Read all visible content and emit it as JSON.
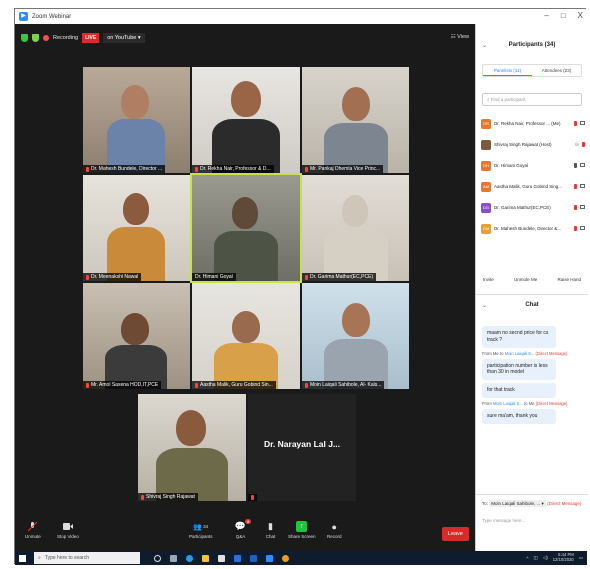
{
  "window": {
    "title": "Zoom Webinar",
    "controls": [
      "–",
      "□",
      "X"
    ]
  },
  "topstrip": {
    "recording": "Recording",
    "live": "LIVE",
    "live_target": "on YouTube ▾",
    "view": "View"
  },
  "tiles": [
    {
      "name": "Dr. Mahesh Bundele, Director ...",
      "muted": true
    },
    {
      "name": "Dr. Rekha Nair, Professor & D...",
      "muted": true
    },
    {
      "name": "Mr. Pankaj Dhemla Vice Princ...",
      "muted": true
    },
    {
      "name": "Dr. Meenakshi Nawal",
      "muted": true
    },
    {
      "name": "Dr. Himani Goyal",
      "muted": false
    },
    {
      "name": "Dr. Garima Mathur(EC,PCE)",
      "muted": true
    },
    {
      "name": "Mr. Amol Saxena HOD,IT,PCE",
      "muted": true
    },
    {
      "name": "Aastha Malik, Guru Gobind Sin...",
      "muted": true
    },
    {
      "name": "Moin Laiqali Sahibole, Al- Kals...",
      "muted": true
    },
    {
      "name": "Shivraj Singh Rajawat",
      "muted": true
    },
    {
      "name": "Dr. Narayan Lal J...",
      "muted": true
    }
  ],
  "controls": {
    "unmute": "Unmute",
    "stop_video": "Stop Video",
    "participants": "Participants",
    "participants_count": "34",
    "qa": "Q&A",
    "qa_badge": "8",
    "chat": "Chat",
    "share": "Share Screen",
    "record": "Record",
    "leave": "Leave"
  },
  "panel": {
    "title": "Participants (34)",
    "tab_panelists": "Panelists (11)",
    "tab_attendees": "Attendees (23)",
    "find_placeholder": "Find a participant",
    "participants": [
      {
        "initials": "DR",
        "color": "#e8772e",
        "name": "Dr. Rekha Nair, Professor ... (Me)"
      },
      {
        "initials": "",
        "color": "#7a5a3a",
        "name": "Shivraj Singh Rajawat (Host)"
      },
      {
        "initials": "DH",
        "color": "#e8772e",
        "name": "Dr. Himani Goyal"
      },
      {
        "initials": "AM",
        "color": "#e8772e",
        "name": "Aastha Malik, Guru Gobind Sing..."
      },
      {
        "initials": "DG",
        "color": "#8a4fc8",
        "name": "Dr. Garima Mathur(EC,PCE)"
      },
      {
        "initials": "DM",
        "color": "#e8a02e",
        "name": "Dr. Mahesh Bundele, Director &..."
      }
    ],
    "invite": "Invite",
    "unmute_me": "Unmute Me",
    "raise_hand": "Raise Hand"
  },
  "chat": {
    "title": "Chat",
    "msg1": "maam no secnd price for cs track ?",
    "from_prefix": "From Me to",
    "from_to": "Moin Laiqali S...",
    "direct": "(Direct Message)",
    "msg2": "participation number is less than 30 in model",
    "msg3": "for that track",
    "from2_prefix": "From",
    "from2_name": "Moin Laiqali S...",
    "from2_mid": "to Me",
    "msg4": "sure ma'am, thank you",
    "to_label": "To:",
    "to_value": "Moin Laiqali Sahibole, ... ▾",
    "to_direct": "(Direct Message)",
    "type_placeholder": "Type message here..."
  },
  "taskbar": {
    "search": "Type here to search",
    "time": "5:44 PM",
    "date": "12/10/2020"
  }
}
